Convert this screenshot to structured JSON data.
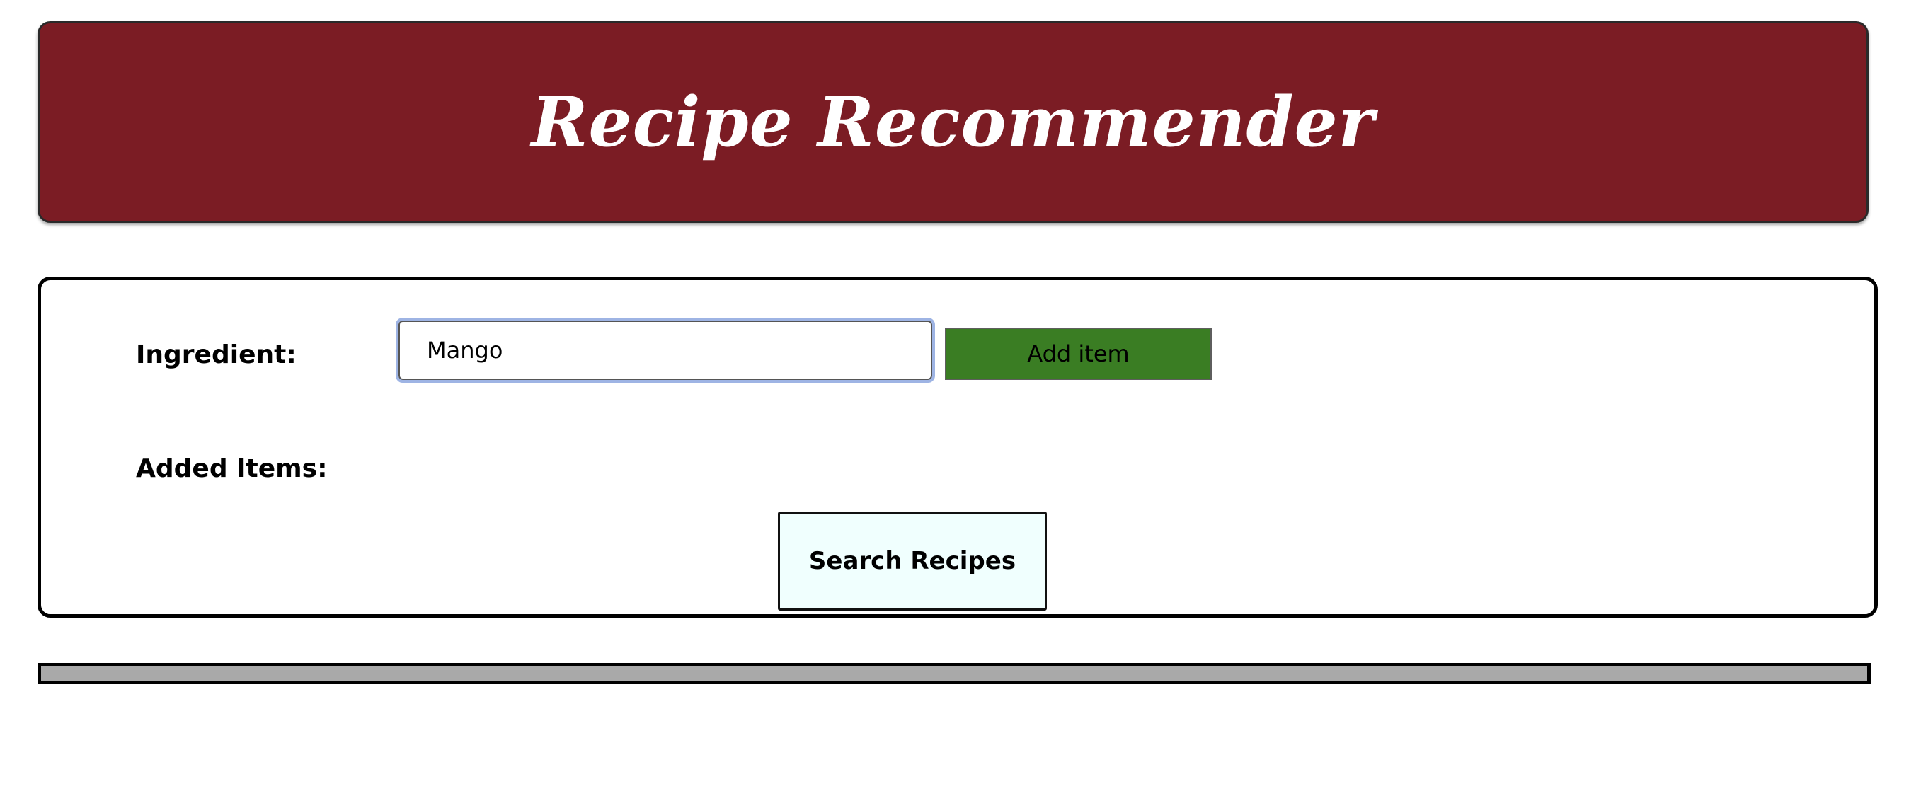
{
  "header": {
    "title": "Recipe Recommender"
  },
  "form": {
    "ingredient_label": "Ingredient:",
    "ingredient_value": "Mango",
    "add_button_label": "Add item",
    "added_items_label": "Added Items:",
    "added_items": [],
    "search_button_label": "Search Recipes"
  },
  "results": {
    "items": []
  },
  "colors": {
    "header_background": "#7b1c24",
    "add_button": "#3a7d23",
    "search_button": "#f0fffe",
    "results_bar": "#a9a9a9"
  }
}
